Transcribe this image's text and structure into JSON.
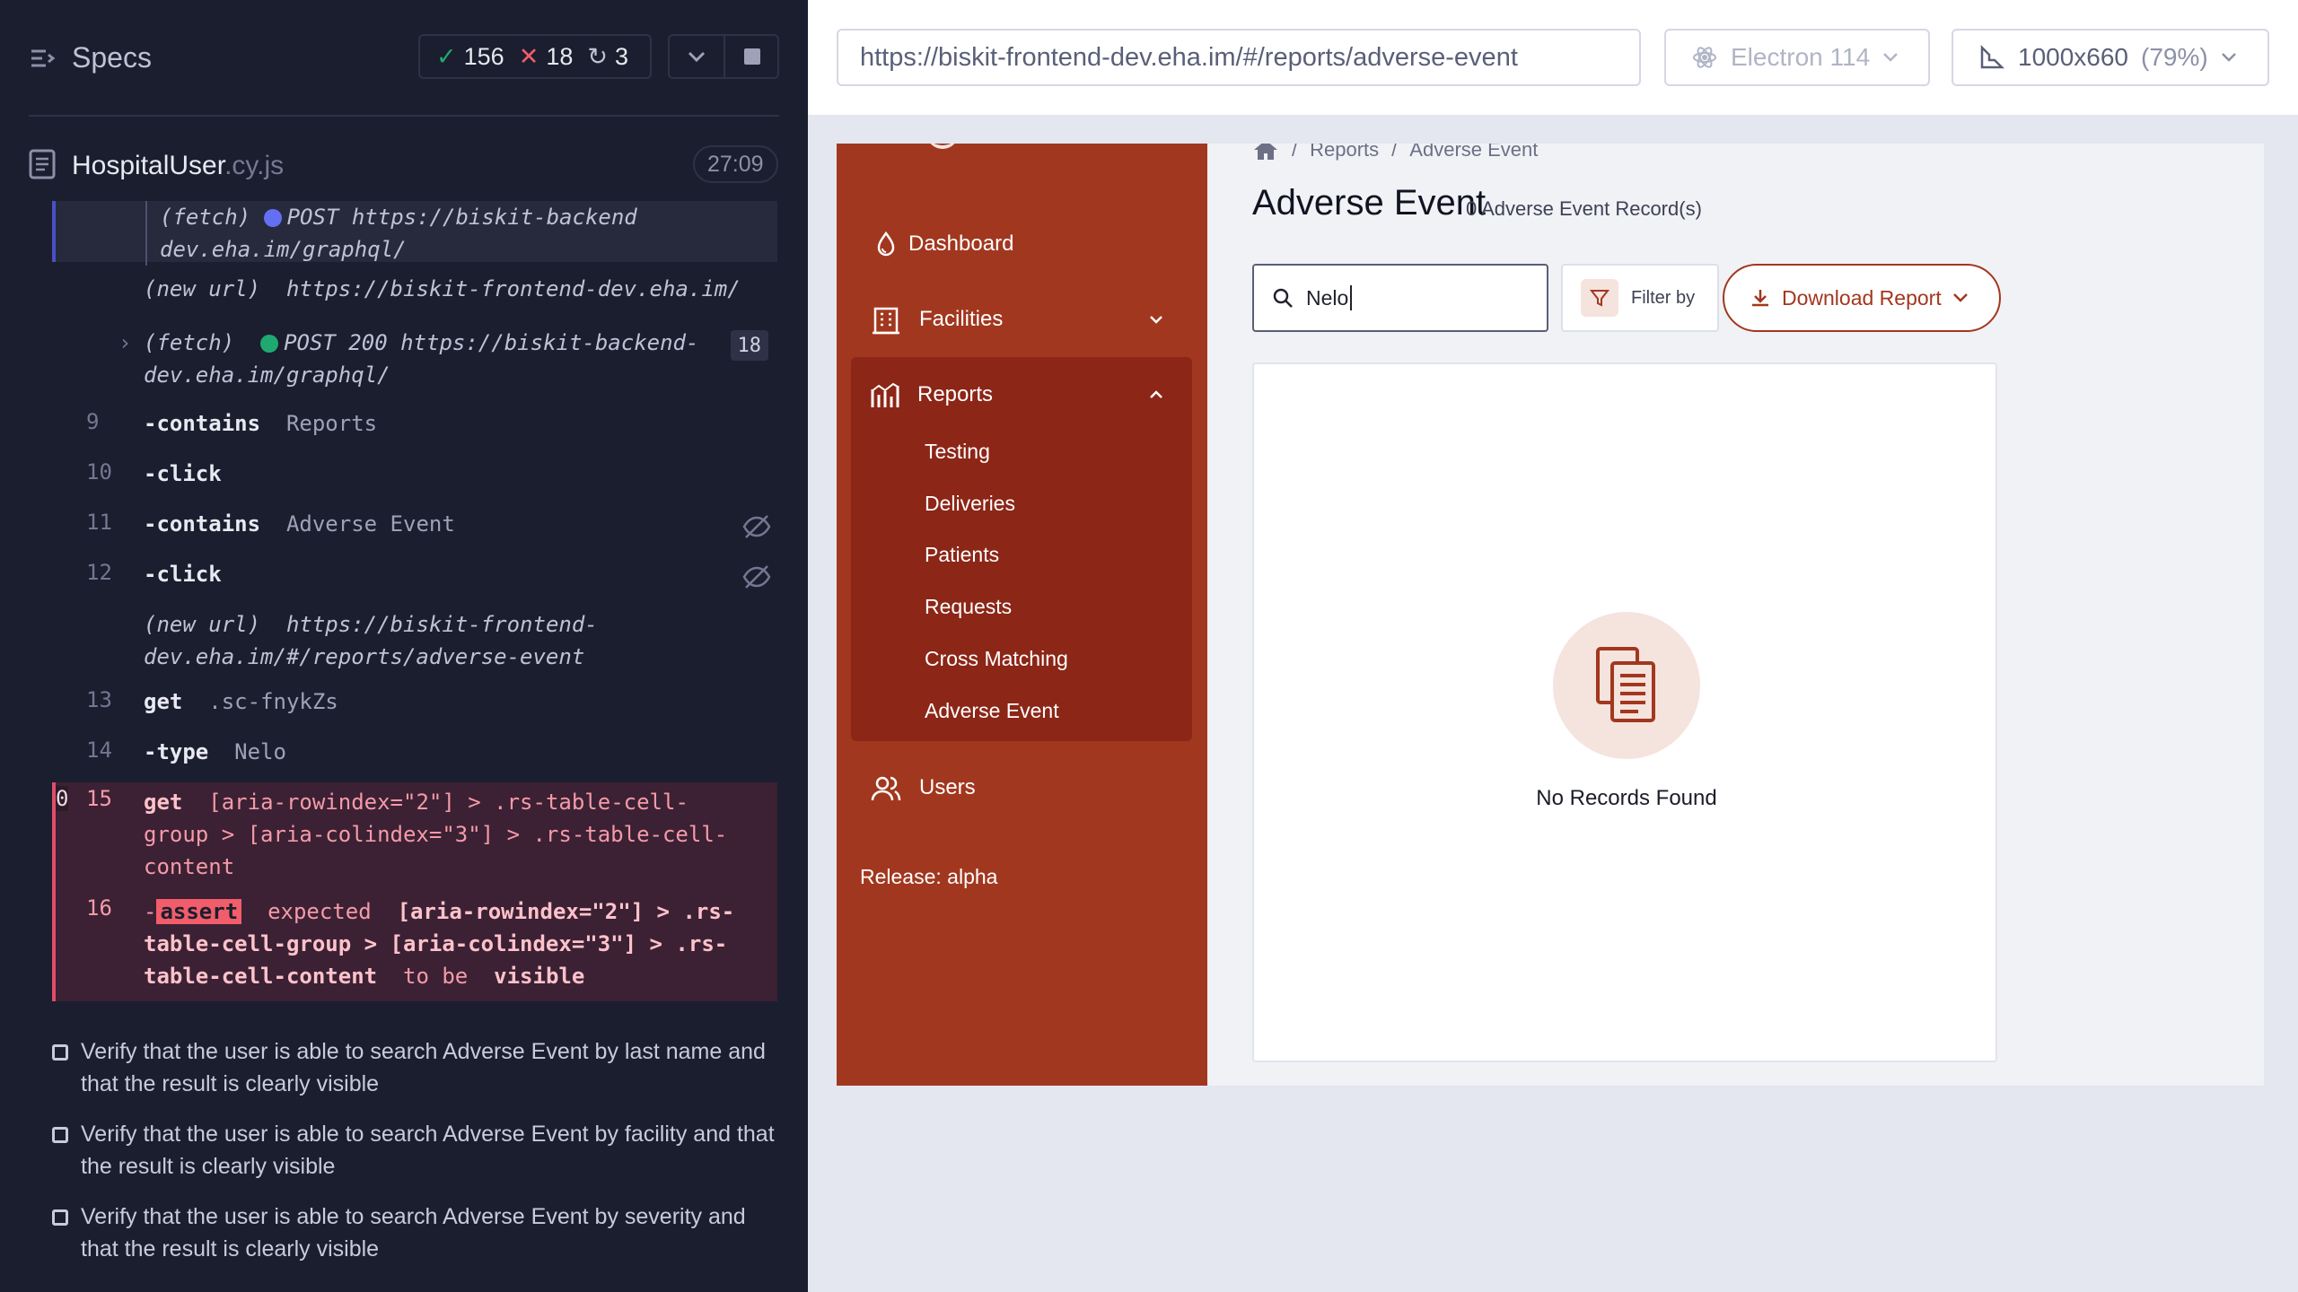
{
  "runner": {
    "header_title": "Specs",
    "stats": {
      "passed": "156",
      "failed": "18",
      "pending": "3"
    },
    "spec_file": {
      "name": "HospitalUser",
      "ext": ".cy.js",
      "duration": "27:09"
    },
    "log": {
      "cut_fetch_label": "(fetch)",
      "cut_fetch_text": "POST https://biskit-backend",
      "cut_fetch_text2": "dev.eha.im/graphql/",
      "new_url_label": "(new url)",
      "new_url_1": "https://biskit-frontend-dev.eha.im/",
      "fetch_label": "(fetch)",
      "fetch_text": "POST 200 https://biskit-backend-",
      "fetch_text2": "dev.eha.im/graphql/",
      "fetch_count": "18",
      "c9_num": "9",
      "c9_cmd": "-contains",
      "c9_arg": "Reports",
      "c10_num": "10",
      "c10_cmd": "-click",
      "c11_num": "11",
      "c11_cmd": "-contains",
      "c11_arg": "Adverse Event",
      "c12_num": "12",
      "c12_cmd": "-click",
      "new_url_2a": "https://biskit-frontend-",
      "new_url_2b": "dev.eha.im/#/reports/adverse-event",
      "c13_num": "13",
      "c13_cmd": "get",
      "c13_arg": ".sc-fnykZs",
      "c14_num": "14",
      "c14_cmd": "-type",
      "c14_arg": "Nelo",
      "c15_num": "15",
      "c15_cmd": "get",
      "c15_line1": "[aria-rowindex=\"2\"] > .rs-table-cell-",
      "c15_line2": "group > [aria-colindex=\"3\"] > .rs-table-cell-",
      "c15_line3": "content",
      "c15_count": "0",
      "c16_num": "16",
      "c16_tag": "assert",
      "c16_expected": "expected",
      "c16_line1": "[aria-rowindex=\"2\"] > .rs-",
      "c16_line2": "table-cell-group > [aria-colindex=\"3\"] > .rs-",
      "c16_line3": "table-cell-content",
      "c16_tobe": "to be",
      "c16_visible": "visible"
    },
    "tests": [
      "Verify that the user is able to search Adverse Event by last name and that the result is clearly visible",
      "Verify that the user is able to search Adverse Event by facility and that the result is clearly visible",
      "Verify that the user is able to search Adverse Event by severity and that the result is clearly visible"
    ]
  },
  "browser": {
    "url": "https://biskit-frontend-dev.eha.im/#/reports/adverse-event",
    "browser_name": "Electron 114",
    "viewport": "1000x660",
    "scale": "(79%)"
  },
  "app": {
    "nav": {
      "dashboard": "Dashboard",
      "facilities": "Facilities",
      "reports": "Reports",
      "users": "Users",
      "reports_sub": [
        "Testing",
        "Deliveries",
        "Patients",
        "Requests",
        "Cross Matching",
        "Adverse Event"
      ]
    },
    "release": "Release: alpha",
    "breadcrumb": {
      "sep": "/",
      "reports": "Reports",
      "current": "Adverse Event"
    },
    "title": "Adverse Event",
    "record_count": "0 Adverse Event Record(s)",
    "search_value": "Nelo",
    "filter_label": "Filter by",
    "download_label": "Download Report",
    "empty_text": "No Records Found"
  },
  "colors": {
    "brand": "#a2371f",
    "sidebar_active": "#8c2617",
    "pass": "#1fa971",
    "fail": "#f15d6a"
  }
}
